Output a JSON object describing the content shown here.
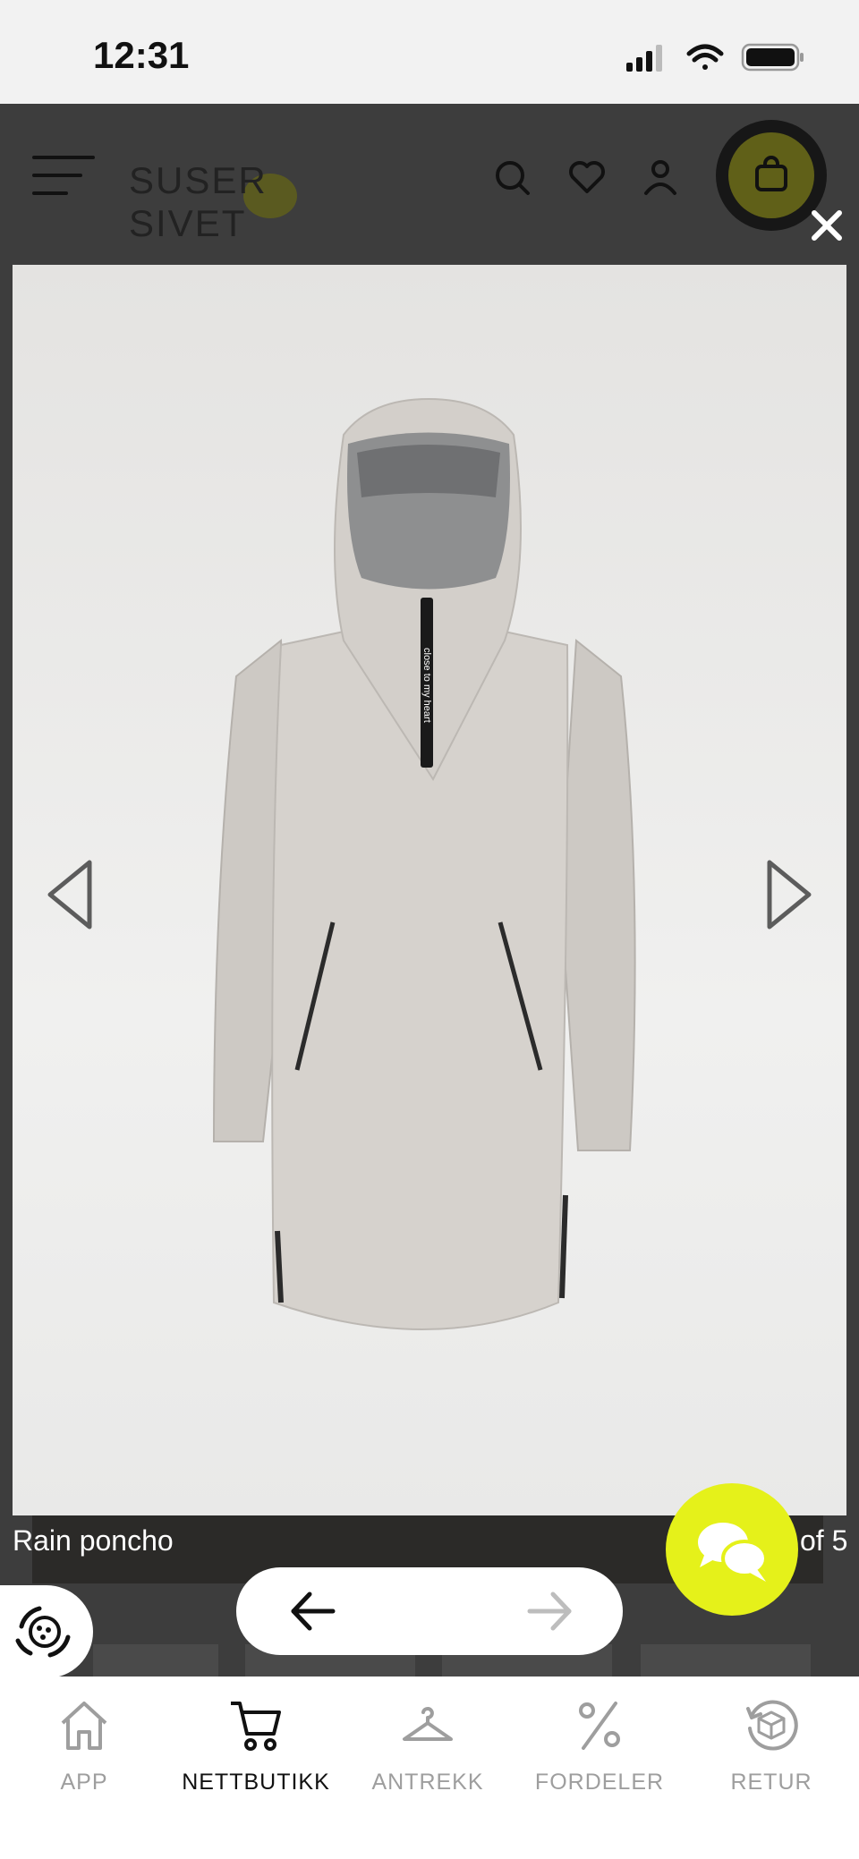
{
  "status_bar": {
    "time": "12:31"
  },
  "header": {
    "logo_text": "SUSER SIVET",
    "icons": [
      "menu-icon",
      "search-icon",
      "heart-icon",
      "user-icon",
      "shopping-bag-icon"
    ]
  },
  "lightbox": {
    "caption": "Rain poncho",
    "counter": "of 5",
    "product_print": "close to my heart",
    "close_icon": "close-icon"
  },
  "bottom_nav": {
    "back_icon": "arrow-left-icon",
    "forward_icon": "arrow-right-icon"
  },
  "tabs": [
    {
      "label": "APP",
      "icon": "house-icon",
      "active": false
    },
    {
      "label": "NETTBUTIKK",
      "icon": "cart-icon",
      "active": true
    },
    {
      "label": "ANTREKK",
      "icon": "hanger-icon",
      "active": false
    },
    {
      "label": "FORDELER",
      "icon": "percent-icon",
      "active": false
    },
    {
      "label": "RETUR",
      "icon": "return-box-icon",
      "active": false
    }
  ],
  "colors": {
    "accent": "#e5f11a",
    "overlay": "#3d3d3d",
    "active_tab": "#111111",
    "inactive_tab": "#9e9e9e"
  }
}
